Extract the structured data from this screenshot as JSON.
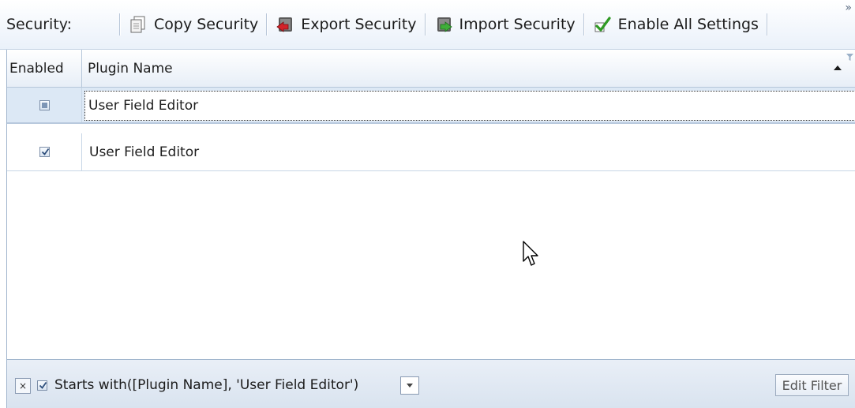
{
  "toolbar": {
    "label": "Security:",
    "copy_label": "Copy Security",
    "export_label": "Export Security",
    "import_label": "Import Security",
    "enable_all_label": "Enable All Settings",
    "overflow": "»"
  },
  "grid": {
    "columns": [
      "Enabled",
      "Plugin Name"
    ],
    "filter_row": {
      "enabled": "indeterminate",
      "plugin_name": "User Field Editor"
    },
    "rows": [
      {
        "enabled": true,
        "plugin_name": "User Field Editor"
      }
    ]
  },
  "filter_bar": {
    "close": "×",
    "active": true,
    "expression": "Starts with([Plugin Name], 'User Field Editor')",
    "edit_button": "Edit Filter"
  }
}
